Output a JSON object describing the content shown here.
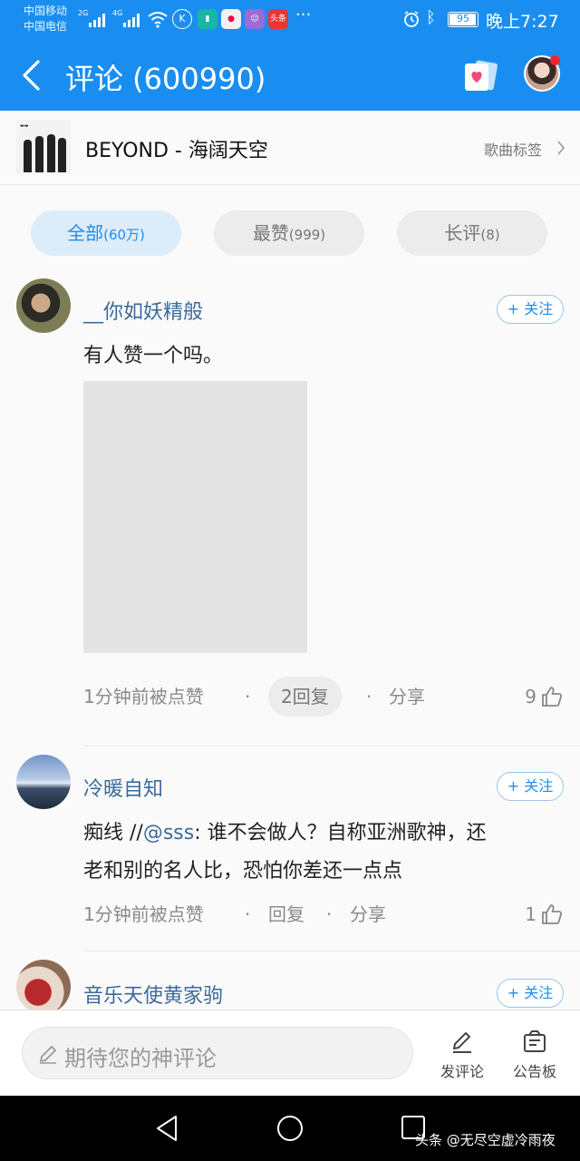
{
  "status_bar": {
    "carrier1": "中国移动",
    "carrier2": "中国电信",
    "net1": "2G",
    "net2": "4G",
    "app_badge": "头条",
    "more": "···",
    "battery": "95",
    "time": "晚上7:27"
  },
  "header": {
    "title": "评论 (600990)",
    "back_icon": "chevron-left-icon",
    "card_icon": "heart-card-icon",
    "accent_color": "#1a8ef0"
  },
  "song": {
    "name": "BEYOND - 海阔天空",
    "tag_label": "歌曲标签"
  },
  "tabs": [
    {
      "label": "全部",
      "count": "(60万)",
      "active": true
    },
    {
      "label": "最赞",
      "count": "(999)",
      "active": false
    },
    {
      "label": "长评",
      "count": "(8)",
      "active": false
    }
  ],
  "comments": [
    {
      "user": "__你如妖精般",
      "follow": "+ 关注",
      "text": "有人赞一个吗。",
      "has_image": true,
      "time": "1分钟前被点赞",
      "reply": "2回复",
      "share": "分享",
      "likes": "9"
    },
    {
      "user": "冷暖自知",
      "follow": "+ 关注",
      "text_prefix": "痴线 //",
      "mention": "@sss",
      "text_line1": ": 谁不会做人？自称亚洲歌神，还",
      "text_line2": "老和别的名人比，恐怕你差还一点点",
      "time": "1分钟前被点赞",
      "reply": "回复",
      "share": "分享",
      "likes": "1"
    },
    {
      "user": "音乐天使黄家驹",
      "follow": "+ 关注"
    }
  ],
  "input_bar": {
    "placeholder": "期待您的神评论",
    "post_label": "发评论",
    "board_label": "公告板"
  },
  "nav_bar": {
    "watermark": "头条 @无尽空虚冷雨夜"
  }
}
